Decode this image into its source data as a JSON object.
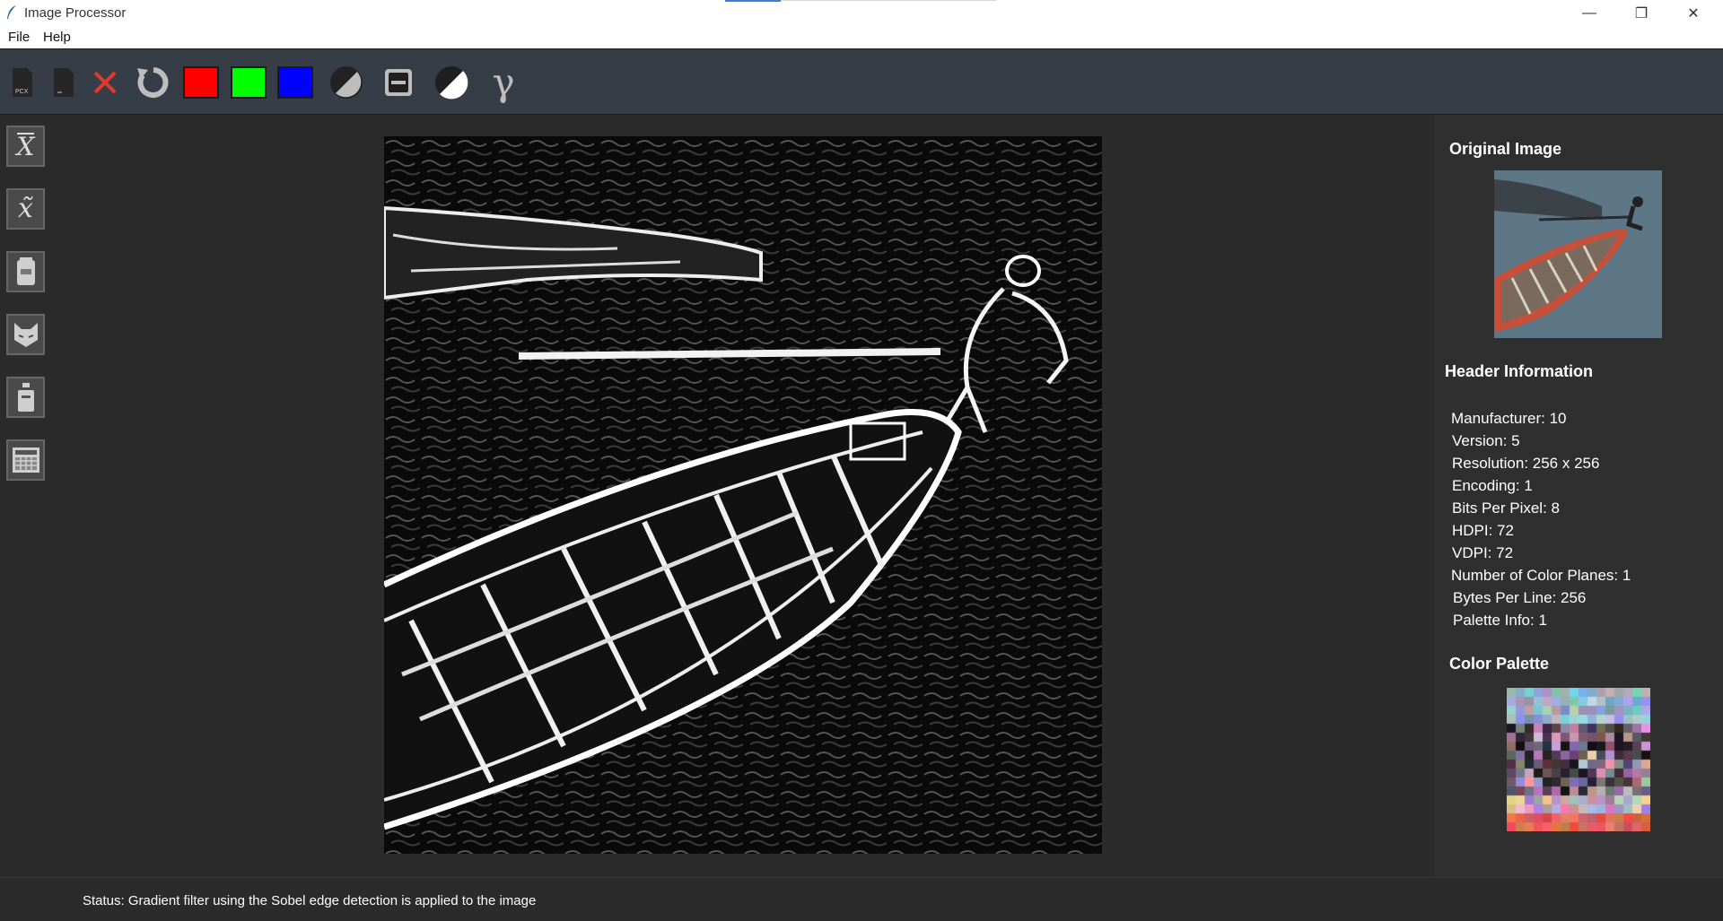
{
  "window": {
    "title": "Image Processor"
  },
  "menu": {
    "file": "File",
    "help": "Help"
  },
  "toolbar": {
    "pcx_icon_label": "PCX",
    "swatches": {
      "red": "#ff0000",
      "green": "#00ff00",
      "blue": "#0000ff"
    },
    "gamma_symbol": "γ"
  },
  "sidebar": {
    "mean_symbol": "X",
    "median_symbol": "x̃"
  },
  "right_panel": {
    "original_title": "Original Image",
    "header_title": "Header Information",
    "header_lines": [
      "Manufacturer: 10",
      "Version: 5",
      "Resolution: 256 x 256",
      "Encoding: 1",
      "Bits Per Pixel: 8",
      "HDPI: 72",
      "VDPI: 72",
      "Number of Color Planes: 1",
      "Bytes Per Line: 256",
      "Palette Info: 1"
    ],
    "palette_title": "Color Palette"
  },
  "status": {
    "text": "Status: Gradient filter using the Sobel edge detection is applied to the image"
  }
}
